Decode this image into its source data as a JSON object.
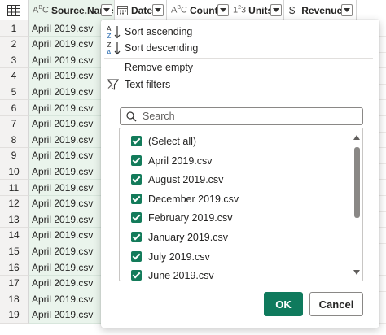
{
  "table": {
    "columns": [
      {
        "name": "Source.Name",
        "type_icon": "ABC"
      },
      {
        "name": "Date",
        "type_icon": "calendar"
      },
      {
        "name": "Country",
        "type_icon": "ABC"
      },
      {
        "name": "Units",
        "type_icon": "123"
      },
      {
        "name": "Revenue",
        "type_icon": "$"
      }
    ],
    "rows": [
      {
        "n": "1",
        "source": "April 2019.csv"
      },
      {
        "n": "2",
        "source": "April 2019.csv"
      },
      {
        "n": "3",
        "source": "April 2019.csv"
      },
      {
        "n": "4",
        "source": "April 2019.csv"
      },
      {
        "n": "5",
        "source": "April 2019.csv"
      },
      {
        "n": "6",
        "source": "April 2019.csv"
      },
      {
        "n": "7",
        "source": "April 2019.csv"
      },
      {
        "n": "8",
        "source": "April 2019.csv"
      },
      {
        "n": "9",
        "source": "April 2019.csv"
      },
      {
        "n": "10",
        "source": "April 2019.csv"
      },
      {
        "n": "11",
        "source": "April 2019.csv"
      },
      {
        "n": "12",
        "source": "April 2019.csv"
      },
      {
        "n": "13",
        "source": "April 2019.csv"
      },
      {
        "n": "14",
        "source": "April 2019.csv"
      },
      {
        "n": "15",
        "source": "April 2019.csv"
      },
      {
        "n": "16",
        "source": "April 2019.csv"
      },
      {
        "n": "17",
        "source": "April 2019.csv"
      },
      {
        "n": "18",
        "source": "April 2019.csv"
      },
      {
        "n": "19",
        "source": "April 2019.csv"
      }
    ]
  },
  "menu": {
    "sort_ascending": "Sort ascending",
    "sort_descending": "Sort descending",
    "remove_empty": "Remove empty",
    "text_filters": "Text filters",
    "search_placeholder": "Search",
    "items": [
      {
        "label": "(Select all)",
        "checked": true
      },
      {
        "label": "April 2019.csv",
        "checked": true
      },
      {
        "label": "August 2019.csv",
        "checked": true
      },
      {
        "label": "December 2019.csv",
        "checked": true
      },
      {
        "label": "February 2019.csv",
        "checked": true
      },
      {
        "label": "January 2019.csv",
        "checked": true
      },
      {
        "label": "July 2019.csv",
        "checked": true
      },
      {
        "label": "June 2019.csv",
        "checked": true
      }
    ],
    "ok_label": "OK",
    "cancel_label": "Cancel"
  },
  "colors": {
    "accent": "#0f7a5d",
    "checkbox": "#137b5a",
    "selected_column": "#eaf4ec"
  }
}
